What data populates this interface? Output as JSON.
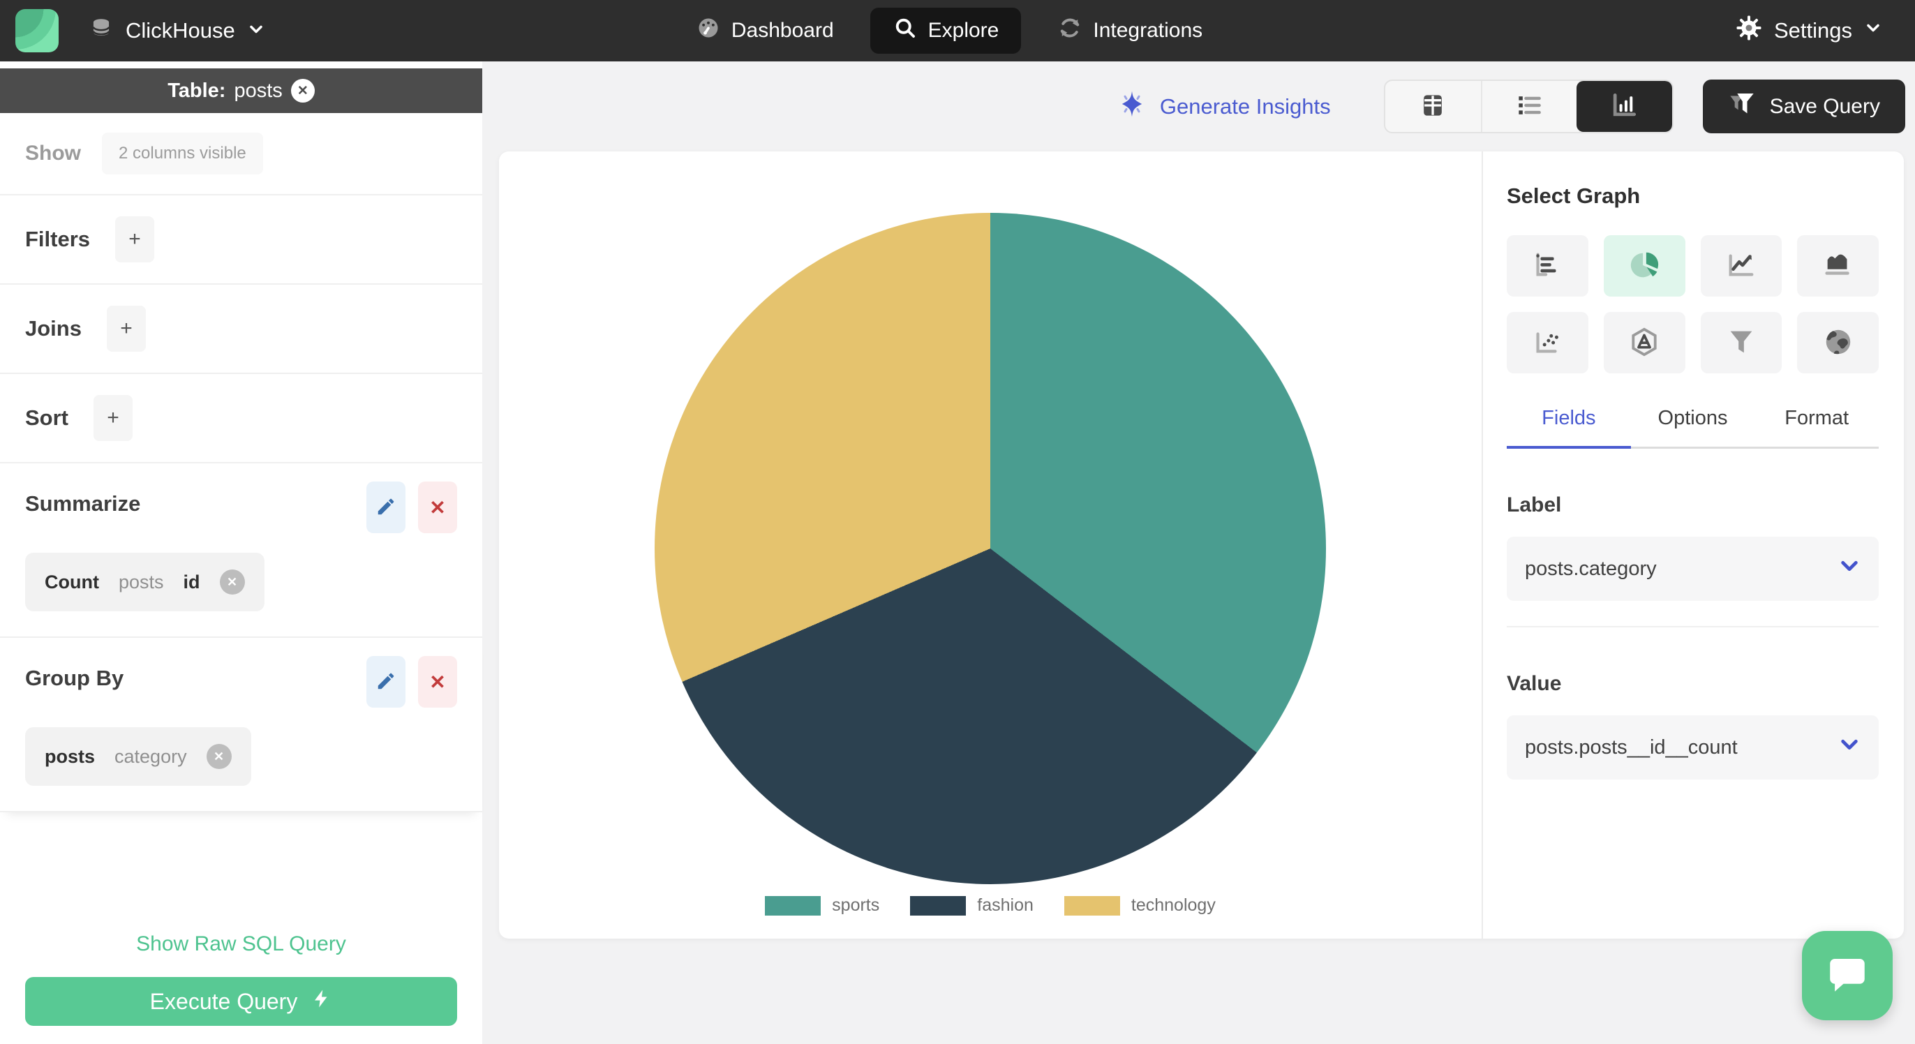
{
  "nav": {
    "brand": {
      "label": "ClickHouse"
    },
    "items": [
      {
        "label": "Dashboard",
        "icon": "dashboard-icon",
        "active": false
      },
      {
        "label": "Explore",
        "icon": "search-icon",
        "active": true
      },
      {
        "label": "Integrations",
        "icon": "sync-icon",
        "active": false
      }
    ],
    "settings_label": "Settings"
  },
  "sidebar": {
    "table_header": {
      "prefix": "Table:",
      "name": "posts"
    },
    "show_label": "Show",
    "show_chip": "2 columns visible",
    "sections": [
      {
        "label": "Filters",
        "add_label": "+"
      },
      {
        "label": "Joins",
        "add_label": "+"
      },
      {
        "label": "Sort",
        "add_label": "+"
      }
    ],
    "summarize": {
      "label": "Summarize",
      "chip": {
        "agg": "Count",
        "table": "posts",
        "column": "id"
      }
    },
    "group_by": {
      "label": "Group By",
      "chip": {
        "table": "posts",
        "column": "category"
      }
    },
    "raw_sql_link": "Show Raw SQL Query",
    "execute_button": "Execute Query"
  },
  "toolbar": {
    "generate_insights": "Generate Insights",
    "save_query": "Save Query",
    "active_view": "chart"
  },
  "graph_panel": {
    "title": "Select Graph",
    "selected_graph": "pie-chart",
    "graph_types": [
      "bar-chart-horizontal",
      "pie-chart",
      "line-chart",
      "area-chart",
      "scatter-plot",
      "radar-chart",
      "funnel-chart",
      "globe-chart"
    ],
    "tabs": [
      {
        "label": "Fields",
        "active": true
      },
      {
        "label": "Options",
        "active": false
      },
      {
        "label": "Format",
        "active": false
      }
    ],
    "label_field": {
      "heading": "Label",
      "value": "posts.category"
    },
    "value_field": {
      "heading": "Value",
      "value": "posts.posts__id__count"
    }
  },
  "chart_data": {
    "type": "pie",
    "categories": [
      "sports",
      "fashion",
      "technology"
    ],
    "values": [
      35.4,
      33.1,
      31.5
    ],
    "value_note": "percent share estimated from slice angles; no numeric labels shown",
    "colors": [
      "#4A9D90",
      "#2C4150",
      "#E5C36E"
    ],
    "title": "",
    "legend_position": "bottom"
  },
  "colors": {
    "accent_green": "#58C994",
    "link_green": "#4EC38F",
    "indigo_accent": "#4A5BD0",
    "edit_blue": "#3A6FAC",
    "delete_red": "#C23B3B",
    "nav_bg": "#2E2E2E",
    "sidebar_header_bg": "#4C4C4C",
    "main_bg": "#F2F2F3",
    "selected_graph_bg": "#E0F6EC"
  }
}
